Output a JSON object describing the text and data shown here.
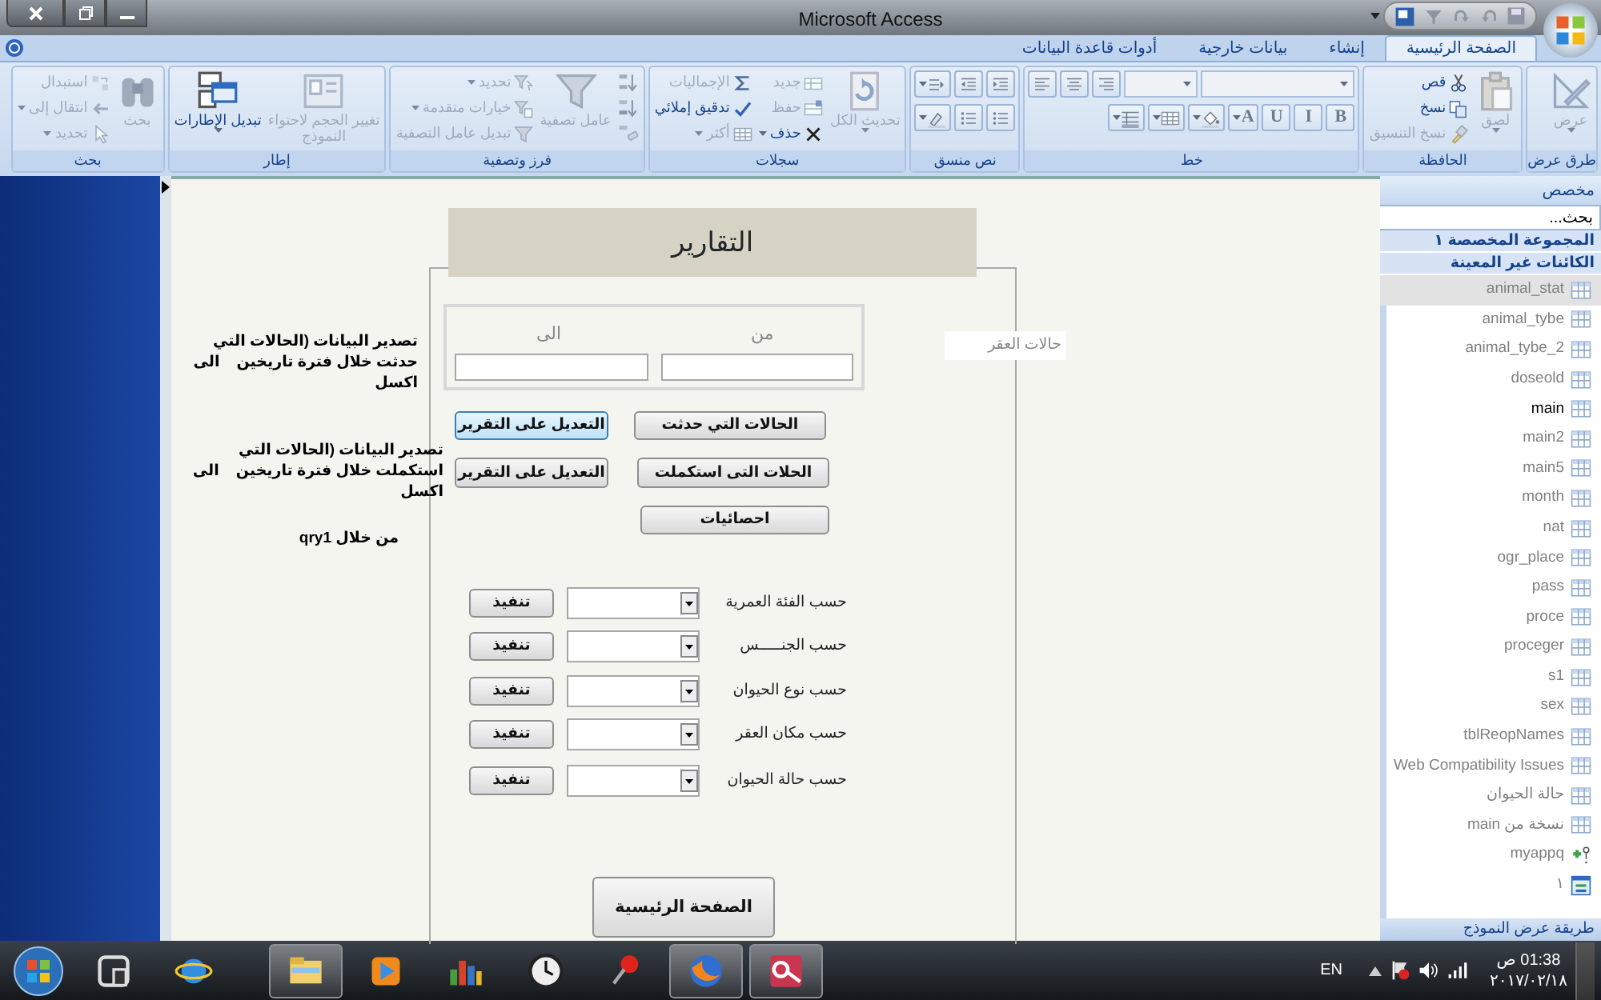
{
  "window": {
    "title": "Microsoft Access"
  },
  "ribbon_tabs": [
    {
      "label": "الصفحة الرئيسية",
      "selected": true
    },
    {
      "label": "إنشاء",
      "selected": false
    },
    {
      "label": "بيانات خارجية",
      "selected": false
    },
    {
      "label": "أدوات قاعدة البيانات",
      "selected": false
    }
  ],
  "ribbon_groups": [
    {
      "title": "طرق عرض",
      "items": [
        {
          "kind": "large",
          "label": "عرض",
          "disabled": true,
          "dropdown": true
        }
      ]
    },
    {
      "title": "الحافظة",
      "items": [
        {
          "kind": "large",
          "label": "لصق",
          "disabled": true,
          "dropdown": true
        },
        {
          "kind": "small",
          "label": "قص",
          "disabled": false
        },
        {
          "kind": "small",
          "label": "نسخ",
          "disabled": false
        },
        {
          "kind": "small",
          "label": "نسخ التنسيق",
          "disabled": true
        }
      ]
    },
    {
      "title": "خط",
      "rows": [
        [
          {
            "kind": "combo"
          },
          {
            "kind": "combo"
          },
          {
            "kind": "iconbtn"
          },
          {
            "kind": "iconbtn"
          },
          {
            "kind": "iconbtn"
          }
        ],
        [
          {
            "kind": "char",
            "label": "B"
          },
          {
            "kind": "char",
            "label": "I"
          },
          {
            "kind": "char",
            "label": "U"
          },
          {
            "kind": "char",
            "label": "A",
            "dropdown": true
          },
          {
            "kind": "iconbtn",
            "dropdown": true
          },
          {
            "kind": "iconbtn",
            "dropdown": true
          },
          {
            "kind": "iconbtn",
            "dropdown": true
          }
        ]
      ]
    },
    {
      "title": "نص منسق",
      "rows": [
        [
          {
            "kind": "iconbtn"
          },
          {
            "kind": "iconbtn"
          },
          {
            "kind": "iconbtn",
            "dropdown": true
          }
        ],
        [
          {
            "kind": "iconbtn"
          },
          {
            "kind": "iconbtn"
          },
          {
            "kind": "iconbtn",
            "dropdown": true
          }
        ]
      ]
    },
    {
      "title": "سجلات",
      "items": [
        {
          "kind": "large",
          "label": "تحديث الكل",
          "disabled": true,
          "dropdown": true
        },
        {
          "kind": "small",
          "label": "جديد",
          "disabled": true
        },
        {
          "kind": "small",
          "label": "حفظ",
          "disabled": true
        },
        {
          "kind": "small",
          "label": "حذف",
          "disabled": false,
          "dropdown": true
        },
        {
          "kind": "small",
          "label": "الإجماليات",
          "disabled": true
        },
        {
          "kind": "small",
          "label": "تدقيق إملائي",
          "disabled": false
        },
        {
          "kind": "small",
          "label": "أكثر",
          "disabled": true,
          "dropdown": true
        }
      ]
    },
    {
      "title": "فرز وتصفية",
      "items": [
        {
          "kind": "iconbtn",
          "disabled": true
        },
        {
          "kind": "iconbtn",
          "disabled": true
        },
        {
          "kind": "iconbtn",
          "disabled": true
        },
        {
          "kind": "large",
          "label": "عامل تصفية",
          "disabled": true
        },
        {
          "kind": "small",
          "label": "تحديد",
          "disabled": true,
          "dropdown": true
        },
        {
          "kind": "small",
          "label": "خيارات متقدمة",
          "disabled": true,
          "dropdown": true
        },
        {
          "kind": "small",
          "label": "تبديل عامل التصفية",
          "disabled": true
        }
      ]
    },
    {
      "title": "إطار",
      "items": [
        {
          "kind": "large",
          "label": "تغيير الحجم لاحتواء النموذج",
          "disabled": true
        },
        {
          "kind": "large",
          "label": "تبديل الإطارات",
          "disabled": false,
          "dropdown": true
        }
      ]
    },
    {
      "title": "بحث",
      "items": [
        {
          "kind": "large",
          "label": "بحث",
          "disabled": true
        },
        {
          "kind": "small",
          "label": "استبدال",
          "disabled": true
        },
        {
          "kind": "small",
          "label": "انتقال إلى",
          "disabled": true,
          "dropdown": true
        },
        {
          "kind": "small",
          "label": "تحديد",
          "disabled": true,
          "dropdown": true
        }
      ]
    }
  ],
  "form": {
    "title": "التقارير",
    "date_range": {
      "from_label": "من",
      "to_label": "الى"
    },
    "buttons": [
      {
        "label": "الحالات التي حدثت",
        "focused": false
      },
      {
        "label": "التعديل على التقرير",
        "focused": true
      },
      {
        "label": "الحلات  التى استكملت",
        "focused": false
      },
      {
        "label": "التعديل على التقرير",
        "focused": false
      },
      {
        "label": "احصائيات",
        "focused": false
      }
    ],
    "notes": [
      "تصدير البيانات (الحالات التي حدثت خلال فترة تاريخين    الى اكسل",
      "تصدير البيانات (الحالات التي استكملت خلال فترة تاريخين    الى اكسل",
      "من خلال qry1"
    ],
    "side_label": "حالات العقر",
    "filters": [
      {
        "label": "حسب الفئة العمرية",
        "button": "تنفيذ"
      },
      {
        "label": "حسب الجنـــــس",
        "button": "تنفيذ"
      },
      {
        "label": "حسب نوع الحيوان",
        "button": "تنفيذ"
      },
      {
        "label": "حسب مكان العقر",
        "button": "تنفيذ"
      },
      {
        "label": "حسب حالة الحيوان",
        "button": "تنفيذ"
      }
    ],
    "home_button": "الصفحة الرئيسية"
  },
  "nav_pane": {
    "title": "مخصص",
    "search_placeholder": "بحث...",
    "groups": [
      "المجموعة المخصصة ١",
      "الكائنات غير المعينة"
    ],
    "items": [
      {
        "label": "animal_stat",
        "kind": "table",
        "selected": true,
        "open": false
      },
      {
        "label": "animal_tybe",
        "kind": "table",
        "selected": false,
        "open": false
      },
      {
        "label": "animal_tybe_2",
        "kind": "table",
        "selected": false,
        "open": false
      },
      {
        "label": "doseold",
        "kind": "table",
        "selected": false,
        "open": false
      },
      {
        "label": "main",
        "kind": "table",
        "selected": false,
        "open": true
      },
      {
        "label": "main2",
        "kind": "table",
        "selected": false,
        "open": false
      },
      {
        "label": "main5",
        "kind": "table",
        "selected": false,
        "open": false
      },
      {
        "label": "month",
        "kind": "table",
        "selected": false,
        "open": false
      },
      {
        "label": "nat",
        "kind": "table",
        "selected": false,
        "open": false
      },
      {
        "label": "ogr_place",
        "kind": "table",
        "selected": false,
        "open": false
      },
      {
        "label": "pass",
        "kind": "table",
        "selected": false,
        "open": false
      },
      {
        "label": "proce",
        "kind": "table",
        "selected": false,
        "open": false
      },
      {
        "label": "proceger",
        "kind": "table",
        "selected": false,
        "open": false
      },
      {
        "label": "s1",
        "kind": "table",
        "selected": false,
        "open": false
      },
      {
        "label": "sex",
        "kind": "table",
        "selected": false,
        "open": false
      },
      {
        "label": "tblReopNames",
        "kind": "table",
        "selected": false,
        "open": false
      },
      {
        "label": "Web Compatibility Issues",
        "kind": "table",
        "selected": false,
        "open": false
      },
      {
        "label": "حالة الحيوان",
        "kind": "table",
        "selected": false,
        "open": false
      },
      {
        "label": "نسخة من main",
        "kind": "table",
        "selected": false,
        "open": false
      },
      {
        "label": "myappq",
        "kind": "query",
        "selected": false,
        "open": false
      },
      {
        "label": "١",
        "kind": "form",
        "selected": false,
        "open": false
      }
    ]
  },
  "status_bar": {
    "text": "طريقة عرض النموذج"
  },
  "taskbar": {
    "apps": [
      {
        "running": false
      },
      {
        "running": false
      },
      {
        "running": true
      },
      {
        "running": false
      },
      {
        "running": false
      },
      {
        "running": false
      },
      {
        "running": false
      },
      {
        "running": true
      },
      {
        "running": true
      }
    ],
    "language": "EN",
    "time": "01:38 ص",
    "date": "٢٠١٧/٠٢/١٨"
  }
}
